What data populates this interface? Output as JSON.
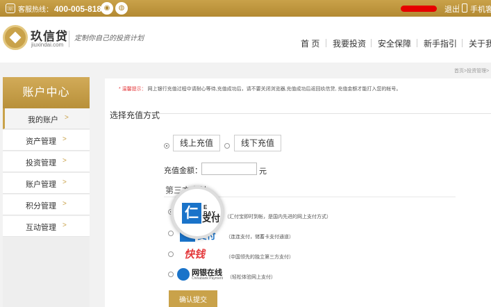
{
  "topbar": {
    "hotline_label": "客服热线：",
    "hotline_number": "400-005-8181",
    "logout": "退出",
    "mobile_client": "手机客户端"
  },
  "header": {
    "logo_cn": "玖信贷",
    "logo_en": "jiuxindai.com",
    "slogan": "定制你自己的投资计划"
  },
  "nav": [
    {
      "label": "首 页"
    },
    {
      "label": "我要投资"
    },
    {
      "label": "安全保障"
    },
    {
      "label": "新手指引"
    },
    {
      "label": "关于我们"
    }
  ],
  "breadcrumb": "首页>投资管理>",
  "sidebar": {
    "title": "账户中心",
    "items": [
      {
        "label": "我的账户",
        "arrow": ">"
      },
      {
        "label": "资产管理",
        "arrow": ">"
      },
      {
        "label": "投资管理",
        "arrow": ">"
      },
      {
        "label": "账户管理",
        "arrow": ">"
      },
      {
        "label": "积分管理",
        "arrow": ">"
      },
      {
        "label": "互动管理",
        "arrow": ">"
      }
    ]
  },
  "main": {
    "notice_warn": "* 温馨提示：",
    "notice_text": "网上银行充值过程中请耐心等待,充值成功后，请不要关闭浏览器,充值成功后返回玖信贷, 充值金额才能打入您的帐号。",
    "section_title": "选择充值方式",
    "methods": [
      {
        "label": "线上充值",
        "checked": true
      },
      {
        "label": "线下充值",
        "checked": false
      }
    ],
    "amount_label": "充值金额：",
    "amount_value": "",
    "amount_unit": "元",
    "third_party_title": "第三方支付",
    "providers": [
      {
        "logo_text": "E PAY 支付",
        "desc": "（汇付宝即时到帐，是国内先进的网上支付方式）",
        "checked": true
      },
      {
        "logo_text": "支付",
        "desc": "（连连支付，储蓄卡支付通道）",
        "checked": false
      },
      {
        "logo_text": "快钱",
        "desc": "（中国领先的独立第三方支付）",
        "checked": false
      },
      {
        "logo_text": "网银在线",
        "logo_sub": "Chinabank Payment",
        "desc": "（轻松体验网上支付）",
        "checked": false
      }
    ],
    "submit": "确认提交"
  },
  "colors": {
    "brand_gold": "#c9a24a",
    "warning_red": "#e4393c",
    "epay_blue": "#1a73c9"
  }
}
